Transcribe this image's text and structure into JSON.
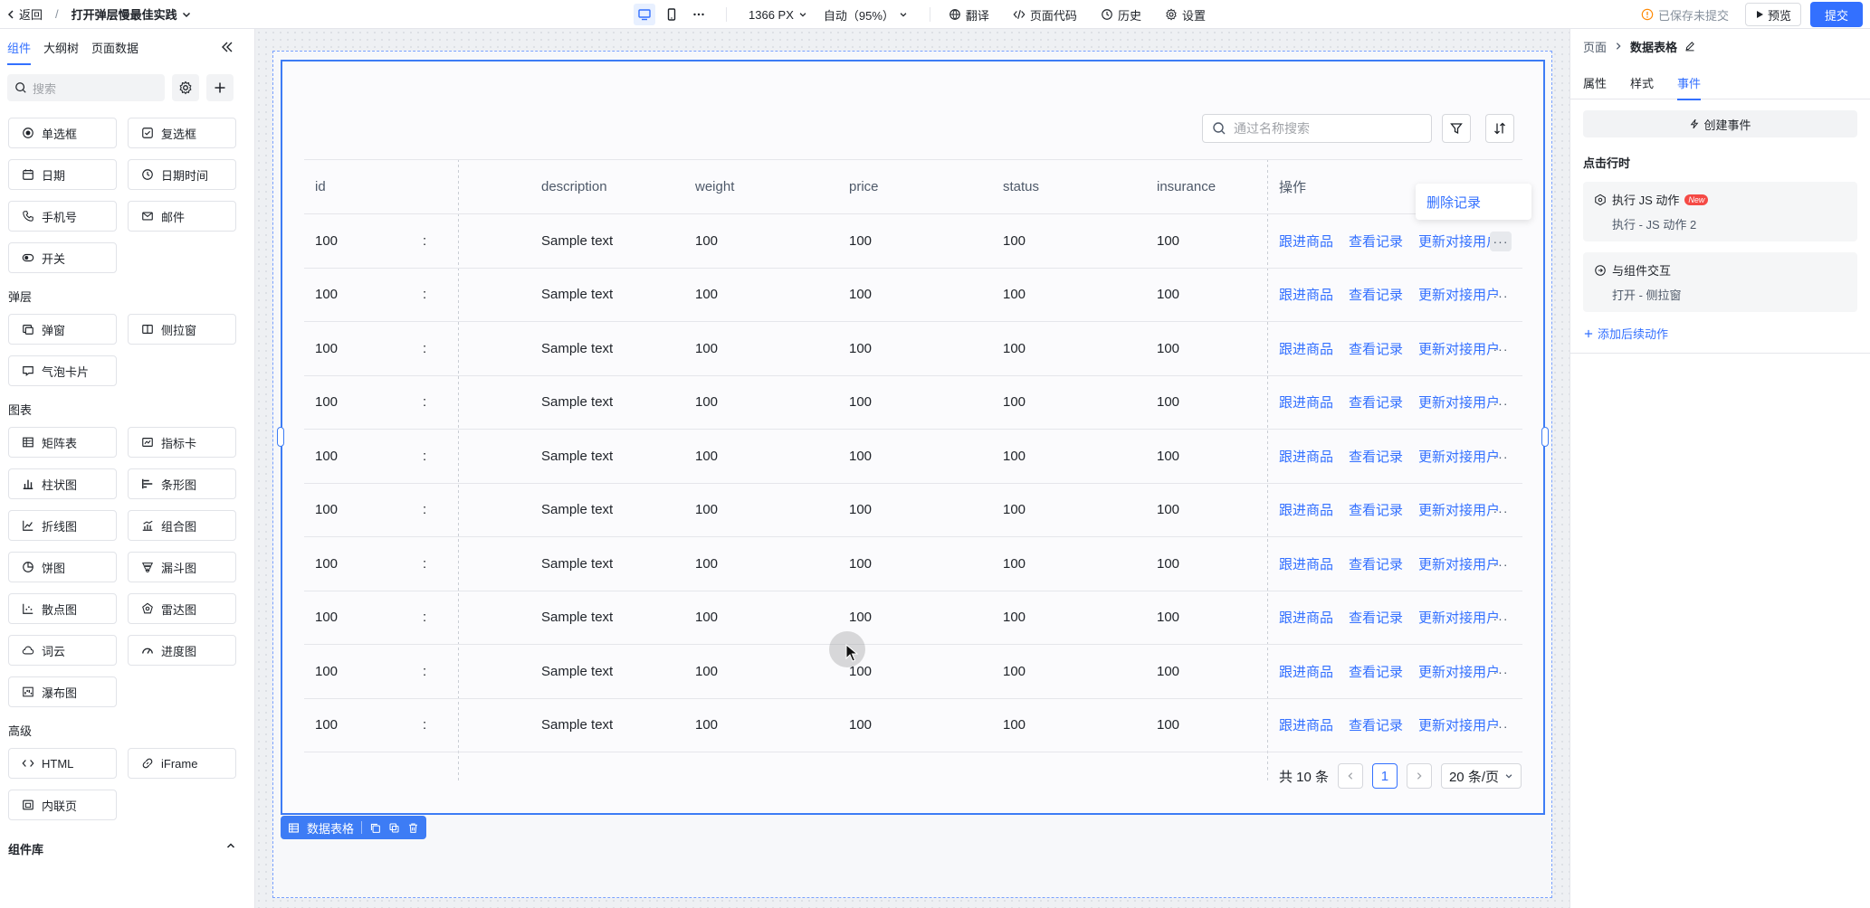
{
  "topbar": {
    "back_label": "返回",
    "page_title": "打开弹层慢最佳实践",
    "width_label": "1366 PX",
    "zoom_label": "自动（95%）",
    "translate_label": "翻译",
    "code_label": "页面代码",
    "history_label": "历史",
    "settings_label": "设置",
    "saved_status": "已保存未提交",
    "preview_label": "预览",
    "submit_label": "提交"
  },
  "left": {
    "tabs": [
      {
        "label": "组件",
        "active": true
      },
      {
        "label": "大纲树",
        "active": false
      },
      {
        "label": "页面数据",
        "active": false
      }
    ],
    "search_placeholder": "搜索",
    "form_items": [
      {
        "label": "单选框",
        "icon": "radio-icon"
      },
      {
        "label": "复选框",
        "icon": "checkbox-icon"
      },
      {
        "label": "日期",
        "icon": "calendar-icon"
      },
      {
        "label": "日期时间",
        "icon": "clock-icon"
      },
      {
        "label": "手机号",
        "icon": "phone-icon"
      },
      {
        "label": "邮件",
        "icon": "mail-icon"
      },
      {
        "label": "开关",
        "icon": "toggle-icon"
      }
    ],
    "popup_title": "弹层",
    "popup_items": [
      {
        "label": "弹窗",
        "icon": "modal-icon"
      },
      {
        "label": "侧拉窗",
        "icon": "drawer-icon"
      },
      {
        "label": "气泡卡片",
        "icon": "bubble-icon"
      }
    ],
    "chart_title": "图表",
    "chart_items": [
      {
        "label": "矩阵表",
        "icon": "matrix-icon"
      },
      {
        "label": "指标卡",
        "icon": "metric-icon"
      },
      {
        "label": "柱状图",
        "icon": "column-chart-icon"
      },
      {
        "label": "条形图",
        "icon": "bar-chart-icon"
      },
      {
        "label": "折线图",
        "icon": "line-chart-icon"
      },
      {
        "label": "组合图",
        "icon": "combo-chart-icon"
      },
      {
        "label": "饼图",
        "icon": "pie-chart-icon"
      },
      {
        "label": "漏斗图",
        "icon": "funnel-icon"
      },
      {
        "label": "散点图",
        "icon": "scatter-icon"
      },
      {
        "label": "雷达图",
        "icon": "radar-icon"
      },
      {
        "label": "词云",
        "icon": "cloud-icon"
      },
      {
        "label": "进度图",
        "icon": "progress-icon"
      },
      {
        "label": "瀑布图",
        "icon": "waterfall-icon"
      }
    ],
    "advanced_title": "高级",
    "advanced_items": [
      {
        "label": "HTML",
        "icon": "code-icon"
      },
      {
        "label": "iFrame",
        "icon": "link-icon"
      },
      {
        "label": "内联页",
        "icon": "inline-page-icon"
      }
    ],
    "library_title": "组件库"
  },
  "table": {
    "search_placeholder": "通过名称搜索",
    "columns": [
      "id",
      "",
      "description",
      "weight",
      "price",
      "status",
      "insurance",
      "操作"
    ],
    "rows": [
      {
        "id": "100",
        "name": ":",
        "description": "Sample text",
        "weight": "100",
        "price": "100",
        "status": "100",
        "insurance": "100"
      },
      {
        "id": "100",
        "name": ":",
        "description": "Sample text",
        "weight": "100",
        "price": "100",
        "status": "100",
        "insurance": "100"
      },
      {
        "id": "100",
        "name": ":",
        "description": "Sample text",
        "weight": "100",
        "price": "100",
        "status": "100",
        "insurance": "100"
      },
      {
        "id": "100",
        "name": ":",
        "description": "Sample text",
        "weight": "100",
        "price": "100",
        "status": "100",
        "insurance": "100"
      },
      {
        "id": "100",
        "name": ":",
        "description": "Sample text",
        "weight": "100",
        "price": "100",
        "status": "100",
        "insurance": "100"
      },
      {
        "id": "100",
        "name": ":",
        "description": "Sample text",
        "weight": "100",
        "price": "100",
        "status": "100",
        "insurance": "100"
      },
      {
        "id": "100",
        "name": ":",
        "description": "Sample text",
        "weight": "100",
        "price": "100",
        "status": "100",
        "insurance": "100"
      },
      {
        "id": "100",
        "name": ":",
        "description": "Sample text",
        "weight": "100",
        "price": "100",
        "status": "100",
        "insurance": "100"
      },
      {
        "id": "100",
        "name": ":",
        "description": "Sample text",
        "weight": "100",
        "price": "100",
        "status": "100",
        "insurance": "100"
      },
      {
        "id": "100",
        "name": ":",
        "description": "Sample text",
        "weight": "100",
        "price": "100",
        "status": "100",
        "insurance": "100"
      }
    ],
    "actions": [
      "跟进商品",
      "查看记录",
      "更新对接用户"
    ],
    "more_glyph": "···",
    "dropdown_item": "删除记录",
    "total_label": "共 10 条",
    "current_page": "1",
    "page_size": "20 条/页",
    "component_tag": "数据表格"
  },
  "right": {
    "breadcrumb_parent": "页面",
    "breadcrumb_current": "数据表格",
    "tabs": [
      {
        "label": "属性",
        "active": false
      },
      {
        "label": "样式",
        "active": false
      },
      {
        "label": "事件",
        "active": true
      }
    ],
    "create_event": "创建事件",
    "event_trigger": "点击行时",
    "event_cards": [
      {
        "title": "执行 JS 动作",
        "badge": "New",
        "detail": "执行 - JS 动作 2",
        "icon": "js-action-icon"
      },
      {
        "title": "与组件交互",
        "badge": "",
        "detail": "打开 - 侧拉窗",
        "icon": "interact-icon"
      }
    ],
    "add_action": "添加后续动作"
  },
  "colors": {
    "accent": "#3370ff",
    "border": "#e5e6eb",
    "danger": "#f54a45"
  }
}
